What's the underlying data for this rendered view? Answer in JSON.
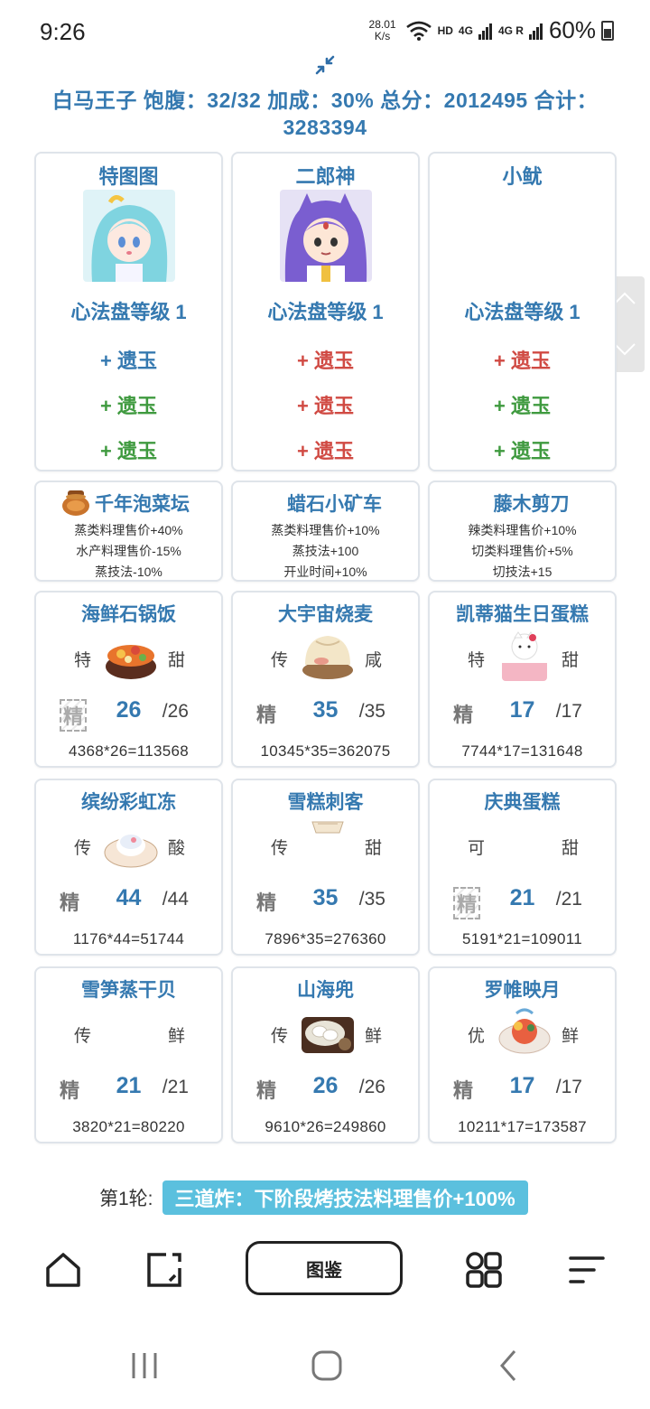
{
  "status_bar": {
    "time": "9:26",
    "net_speed_value": "28.01",
    "net_speed_unit": "K/s",
    "hd": "HD",
    "sig1": "4G",
    "sig2": "4G R",
    "battery": "60%"
  },
  "header": {
    "line1": "白马王子 饱腹：32/32 加成：30% 总分：2012495 合计：",
    "line2": "3283394"
  },
  "chefs": [
    {
      "name": "特图图",
      "disk_level": "心法盘等级 1",
      "slots": [
        {
          "text": "+ 遗玉",
          "color": "blue"
        },
        {
          "text": "+ 遗玉",
          "color": "green"
        },
        {
          "text": "+ 遗玉",
          "color": "green"
        }
      ]
    },
    {
      "name": "二郎神",
      "disk_level": "心法盘等级 1",
      "slots": [
        {
          "text": "+ 遗玉",
          "color": "red"
        },
        {
          "text": "+ 遗玉",
          "color": "red"
        },
        {
          "text": "+ 遗玉",
          "color": "red"
        }
      ]
    },
    {
      "name": "小鱿",
      "disk_level": "心法盘等级 1",
      "slots": [
        {
          "text": "+ 遗玉",
          "color": "red"
        },
        {
          "text": "+ 遗玉",
          "color": "green"
        },
        {
          "text": "+ 遗玉",
          "color": "green"
        }
      ]
    }
  ],
  "equipment": [
    {
      "name": "千年泡菜坛",
      "effects": [
        "蒸类料理售价+40%",
        "水产料理售价-15%",
        "蒸技法-10%"
      ]
    },
    {
      "name": "蜡石小矿车",
      "effects": [
        "蒸类料理售价+10%",
        "蒸技法+100",
        "开业时间+10%"
      ]
    },
    {
      "name": "藤木剪刀",
      "effects": [
        "辣类料理售价+10%",
        "切类料理售价+5%",
        "切技法+15"
      ]
    }
  ],
  "dishes": [
    {
      "name": "海鲜石锅饭",
      "rank": "特",
      "flavor": "甜",
      "quality": "精",
      "count": "26",
      "max": "/26",
      "formula": "4368*26=113568"
    },
    {
      "name": "大宇宙烧麦",
      "rank": "传",
      "flavor": "咸",
      "quality": "精",
      "count": "35",
      "max": "/35",
      "formula": "10345*35=362075"
    },
    {
      "name": "凯蒂猫生日蛋糕",
      "rank": "特",
      "flavor": "甜",
      "quality": "精",
      "count": "17",
      "max": "/17",
      "formula": "7744*17=131648"
    },
    {
      "name": "缤纷彩虹冻",
      "rank": "传",
      "flavor": "酸",
      "quality": "精",
      "count": "44",
      "max": "/44",
      "formula": "1176*44=51744"
    },
    {
      "name": "雪糕刺客",
      "rank": "传",
      "flavor": "甜",
      "quality": "精",
      "count": "35",
      "max": "/35",
      "formula": "7896*35=276360"
    },
    {
      "name": "庆典蛋糕",
      "rank": "可",
      "flavor": "甜",
      "quality": "精",
      "count": "21",
      "max": "/21",
      "formula": "5191*21=109011"
    },
    {
      "name": "雪笋蒸干贝",
      "rank": "传",
      "flavor": "鲜",
      "quality": "精",
      "count": "21",
      "max": "/21",
      "formula": "3820*21=80220"
    },
    {
      "name": "山海兜",
      "rank": "传",
      "flavor": "鲜",
      "quality": "精",
      "count": "26",
      "max": "/26",
      "formula": "9610*26=249860"
    },
    {
      "name": "罗帷映月",
      "rank": "优",
      "flavor": "鲜",
      "quality": "精",
      "count": "17",
      "max": "/17",
      "formula": "10211*17=173587"
    }
  ],
  "round": {
    "label": "第1轮:",
    "badge": "三道炸：下阶段烤技法料理售价+100%"
  },
  "bottom_nav": {
    "main_label": "图鉴",
    "icons": [
      "home-icon",
      "edit-icon",
      "grid-icon",
      "menu-icon"
    ]
  },
  "colors": {
    "primary": "#3579b0",
    "red": "#d04a43",
    "green": "#3f9a3f",
    "badge": "#5bc0de"
  }
}
